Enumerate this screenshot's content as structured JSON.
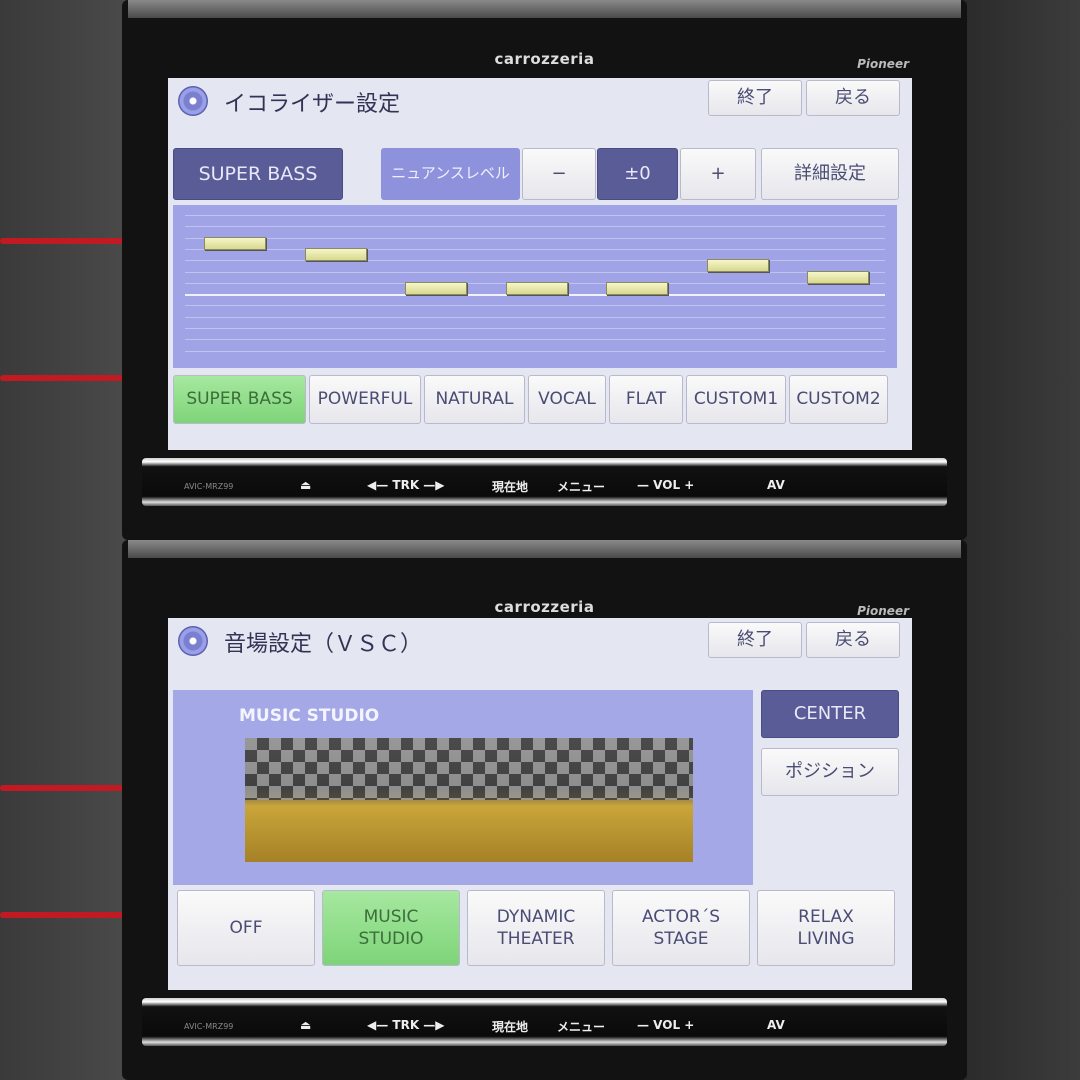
{
  "device": {
    "brand": "carrozzeria",
    "maker": "Pioneer",
    "controls": [
      "⏏",
      "◀— TRK —▶",
      "現在地",
      "メニュー",
      "— VOL +",
      "AV"
    ]
  },
  "eq_screen": {
    "title": "イコライザー設定",
    "exit_label": "終了",
    "back_label": "戻る",
    "current_preset": "SUPER BASS",
    "nuance_label": "ニュアンスレベル",
    "minus_label": "−",
    "level_value": "±0",
    "plus_label": "+",
    "detail_label": "詳細設定",
    "band_levels": [
      4,
      3,
      0,
      0,
      0,
      2,
      1
    ],
    "presets": [
      "SUPER BASS",
      "POWERFUL",
      "NATURAL",
      "VOCAL",
      "FLAT",
      "CUSTOM1",
      "CUSTOM2"
    ],
    "selected_preset": "SUPER BASS"
  },
  "vsc_screen": {
    "title": "音場設定（ＶＳＣ）",
    "exit_label": "終了",
    "back_label": "戻る",
    "scene_label": "MUSIC STUDIO",
    "center_label": "CENTER",
    "position_label": "ポジション",
    "modes": [
      "OFF",
      "MUSIC\nSTUDIO",
      "DYNAMIC\nTHEATER",
      "ACTOR´S\nSTAGE",
      "RELAX\nLIVING"
    ],
    "selected_mode": "MUSIC\nSTUDIO"
  },
  "colors": {
    "accent": "#5a5c98",
    "selected": "#8edc88",
    "panel": "#a0a4e6"
  }
}
